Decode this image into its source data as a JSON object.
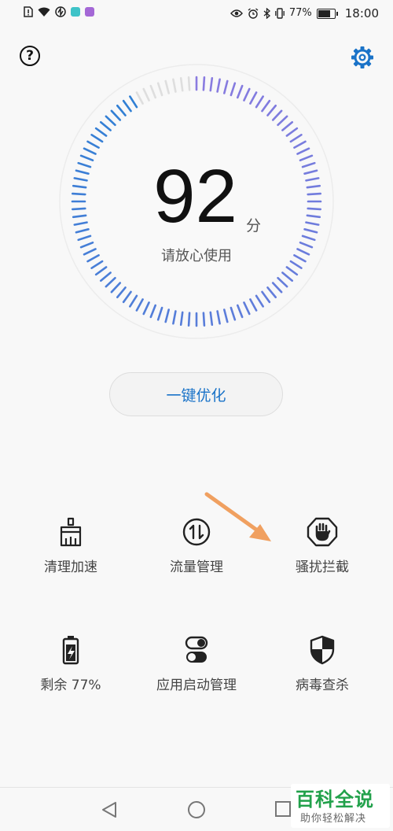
{
  "status_bar": {
    "battery_text": "77%",
    "battery_level": 0.77,
    "time": "18:00",
    "icons": [
      "sim-alert-icon",
      "wifi-icon",
      "data-saver-icon",
      "app-notification-icon",
      "app-notification-icon",
      "eye-comfort-icon",
      "alarm-icon",
      "bluetooth-icon",
      "vibrate-icon",
      "battery-icon"
    ]
  },
  "header": {
    "help_icon": "help-icon",
    "help_glyph": "?",
    "settings_icon": "gear-icon"
  },
  "gauge": {
    "score": "92",
    "unit": "分",
    "status": "请放心使用",
    "score_value": 92,
    "colors": {
      "start": "#8a7be0",
      "end": "#2f7fd4",
      "inactive": "#dedede",
      "track": "#ececec"
    }
  },
  "optimize_button": {
    "label": "一键优化"
  },
  "tools": [
    {
      "label": "清理加速",
      "icon": "broom-icon"
    },
    {
      "label": "流量管理",
      "icon": "data-traffic-icon"
    },
    {
      "label": "骚扰拦截",
      "icon": "hand-block-icon"
    },
    {
      "label": "剩余 77%",
      "icon": "battery-icon"
    },
    {
      "label": "应用启动管理",
      "icon": "toggle-switch-icon"
    },
    {
      "label": "病毒查杀",
      "icon": "shield-icon"
    }
  ],
  "navigation": {
    "back_icon": "back-icon",
    "home_icon": "home-icon",
    "recent_icon": "recent-apps-icon"
  },
  "watermark": {
    "title": "百科全说",
    "subtitle": "助你轻松解决"
  },
  "colors": {
    "accent": "#1a73c8",
    "arrow": "#f0a060"
  }
}
